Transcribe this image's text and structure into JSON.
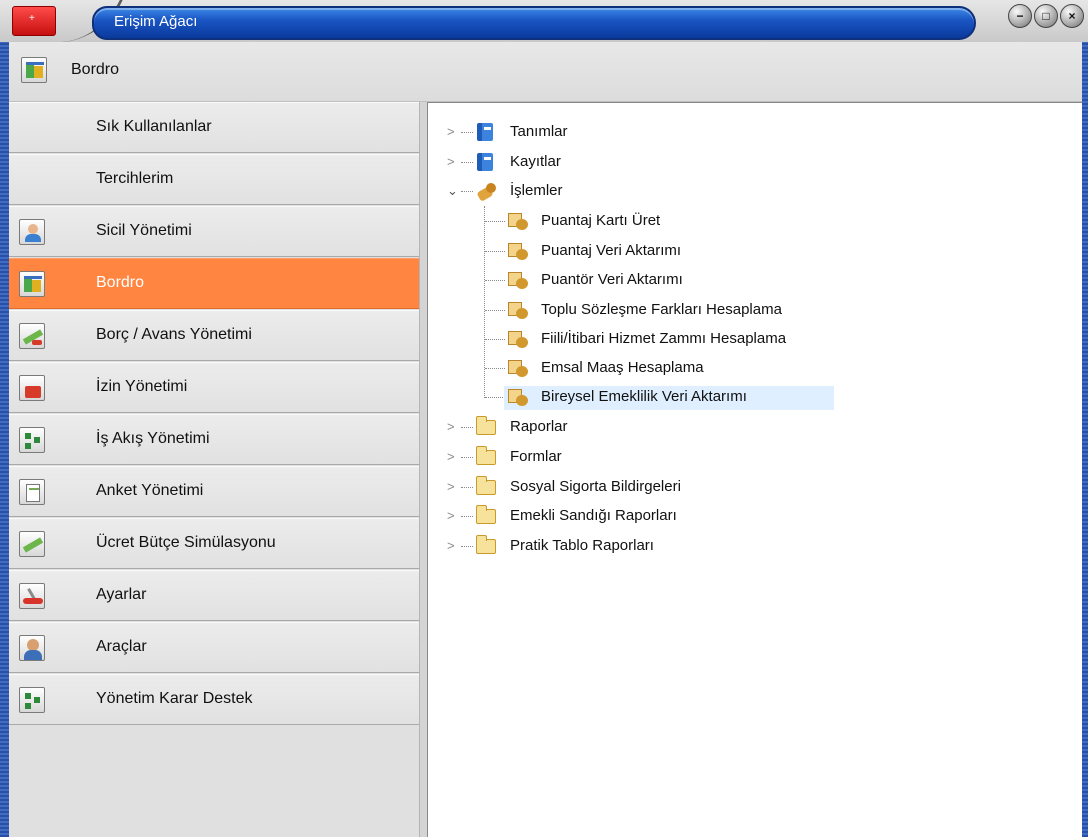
{
  "window": {
    "title": "Erişim Ağacı",
    "controls": {
      "minimize": "−",
      "maximize": "□",
      "close": "×"
    }
  },
  "header": {
    "label": "Bordro",
    "icon": "bordro-icon"
  },
  "sidebar": {
    "items": [
      {
        "label": "Sık Kullanılanlar",
        "icon": null,
        "active": false
      },
      {
        "label": "Tercihlerim",
        "icon": null,
        "active": false
      },
      {
        "label": "Sicil Yönetimi",
        "icon": "personnel-icon",
        "active": false
      },
      {
        "label": "Bordro",
        "icon": "bordro-icon",
        "active": true
      },
      {
        "label": "Borç / Avans Yönetimi",
        "icon": "debt-icon",
        "active": false
      },
      {
        "label": "İzin Yönetimi",
        "icon": "leave-icon",
        "active": false
      },
      {
        "label": "İş Akış Yönetimi",
        "icon": "workflow-icon",
        "active": false
      },
      {
        "label": "Anket Yönetimi",
        "icon": "survey-icon",
        "active": false
      },
      {
        "label": "Ücret Bütçe Simülasyonu",
        "icon": "budget-icon",
        "active": false
      },
      {
        "label": "Ayarlar",
        "icon": "settings-icon",
        "active": false
      },
      {
        "label": "Araçlar",
        "icon": "tools-icon",
        "active": false
      },
      {
        "label": "Yönetim Karar Destek",
        "icon": "decision-icon",
        "active": false
      }
    ]
  },
  "tree": {
    "nodes": [
      {
        "label": "Tanımlar",
        "icon": "book-icon",
        "expanded": false
      },
      {
        "label": "Kayıtlar",
        "icon": "book-icon",
        "expanded": false
      },
      {
        "label": "İşlemler",
        "icon": "operations-icon",
        "expanded": true,
        "children": [
          {
            "label": "Puantaj Kartı Üret"
          },
          {
            "label": "Puantaj Veri Aktarımı"
          },
          {
            "label": "Puantör Veri Aktarımı"
          },
          {
            "label": "Toplu Sözleşme Farkları Hesaplama"
          },
          {
            "label": "Fiili/İtibari Hizmet Zammı Hesaplama"
          },
          {
            "label": "Emsal Maaş Hesaplama"
          },
          {
            "label": "Bireysel Emeklilik Veri Aktarımı",
            "selected": true
          }
        ]
      },
      {
        "label": "Raporlar",
        "icon": "folder-icon",
        "expanded": false
      },
      {
        "label": "Formlar",
        "icon": "folder-icon",
        "expanded": false
      },
      {
        "label": "Sosyal Sigorta Bildirgeleri",
        "icon": "folder-icon",
        "expanded": false
      },
      {
        "label": "Emekli Sandığı Raporları",
        "icon": "folder-icon",
        "expanded": false
      },
      {
        "label": "Pratik Tablo Raporları",
        "icon": "folder-icon",
        "expanded": false
      }
    ]
  }
}
